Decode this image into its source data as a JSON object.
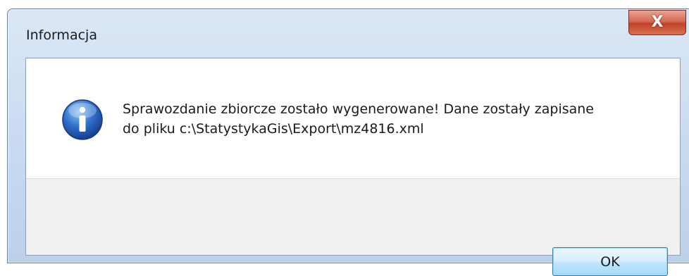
{
  "window": {
    "title": "Informacja",
    "close_glyph": "X"
  },
  "dialog": {
    "icon": "info-icon",
    "message_line1": "Sprawozdanie zbiorcze zostało wygenerowane! Dane zostały zapisane",
    "message_line2": "do pliku c:\\StatystykaGis\\Export\\mz4816.xml"
  },
  "buttons": {
    "ok_label": "OK"
  },
  "colors": {
    "titlebar": "#c9daf0",
    "close_button": "#c3412a",
    "ok_button": "#bee6fd",
    "info_icon": "#1f5fb8"
  }
}
